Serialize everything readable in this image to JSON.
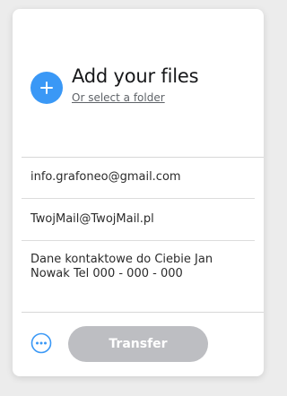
{
  "upload": {
    "title": "Add your files",
    "select_folder_link": "Or select a folder",
    "add_icon": "plus-icon"
  },
  "form": {
    "email_to": "info.grafoneo@gmail.com",
    "email_from": "TwojMail@TwojMail.pl",
    "message": "Dane kontaktowe do Ciebie Jan\nNowak Tel 000 - 000 - 000"
  },
  "footer": {
    "more_icon": "more-options-icon",
    "transfer_label": "Transfer",
    "transfer_disabled": true
  },
  "colors": {
    "accent": "#3a98f6",
    "disabled_button": "#bdbec2",
    "background": "#ececec"
  }
}
